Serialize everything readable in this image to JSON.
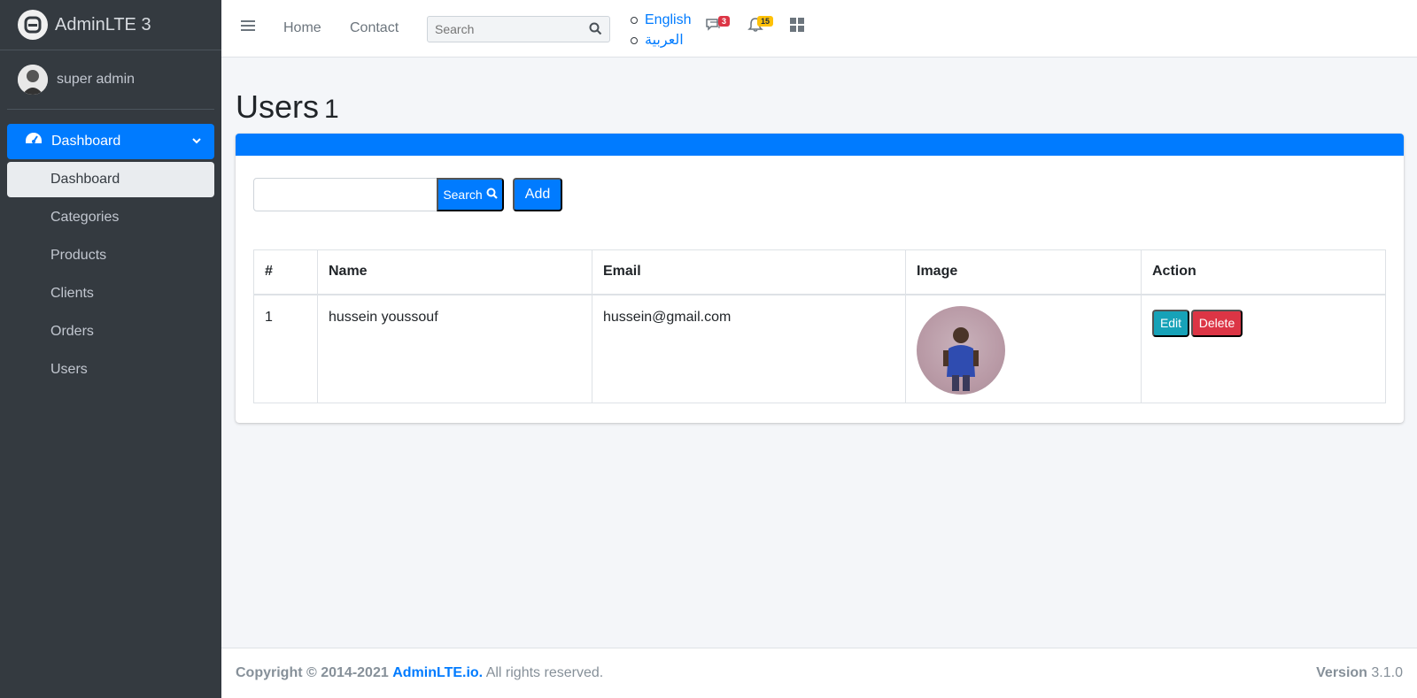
{
  "brand": {
    "name": "AdminLTE 3"
  },
  "user": {
    "name": "super admin"
  },
  "sidebar": {
    "menu_label": "Dashboard",
    "items": [
      {
        "label": "Dashboard"
      },
      {
        "label": "Categories"
      },
      {
        "label": "Products"
      },
      {
        "label": "Clients"
      },
      {
        "label": "Orders"
      },
      {
        "label": "Users"
      }
    ]
  },
  "navbar": {
    "home": "Home",
    "contact": "Contact",
    "search_placeholder": "Search",
    "languages": [
      "English",
      "العربية"
    ],
    "messages_count": "3",
    "notifications_count": "15"
  },
  "page": {
    "title": "Users",
    "count": "1"
  },
  "toolbar": {
    "search_label": "Search",
    "add_label": "Add"
  },
  "table": {
    "headers": [
      "#",
      "Name",
      "Email",
      "Image",
      "Action"
    ],
    "rows": [
      {
        "id": "1",
        "name": "hussein youssouf",
        "email": "hussein@gmail.com",
        "edit": "Edit",
        "delete": "Delete"
      }
    ]
  },
  "footer": {
    "copyright": "Copyright © 2014-2021",
    "brand_link": "AdminLTE.io.",
    "rights": "All rights reserved.",
    "version_label": "Version",
    "version": "3.1.0"
  },
  "colors": {
    "primary": "#007bff",
    "sidebar_bg": "#343a40",
    "info": "#17a2b8",
    "danger": "#dc3545",
    "warning": "#ffc107"
  }
}
